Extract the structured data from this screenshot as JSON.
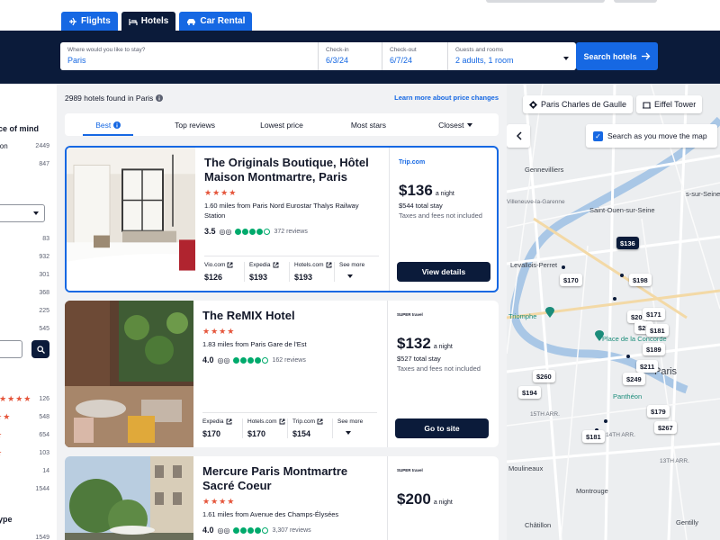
{
  "nav": {
    "tabs": [
      {
        "label": "Flights",
        "icon": "plane-icon"
      },
      {
        "label": "Hotels",
        "icon": "bed-icon"
      },
      {
        "label": "Car Rental",
        "icon": "car-icon"
      }
    ]
  },
  "search": {
    "destination_label": "Where would you like to stay?",
    "destination_value": "Paris",
    "checkin_label": "Check-in",
    "checkin_value": "6/3/24",
    "checkout_label": "Check-out",
    "checkout_value": "6/7/24",
    "guests_label": "Guests and rooms",
    "guests_value": "2 adults, 1 room",
    "button_label": "Search hotels"
  },
  "filters": {
    "heading": "ce of mind",
    "first_item": "ion",
    "counts": [
      "2449",
      "847",
      "83",
      "932",
      "301",
      "368",
      "225",
      "545"
    ],
    "star_rows": [
      {
        "stars": "★★★★★",
        "count": "126"
      },
      {
        "stars": "★★★★",
        "count": "548"
      },
      {
        "stars": "★★★",
        "count": "654"
      },
      {
        "stars": "★★",
        "count": "103"
      },
      {
        "stars": "",
        "count": "14"
      },
      {
        "stars": "",
        "count": "1544"
      }
    ],
    "type_heading": "ype",
    "type_count": "1549"
  },
  "results": {
    "count_text": "2989 hotels found in Paris",
    "learn_more": "Learn more about price changes",
    "sort_options": [
      "Best",
      "Top reviews",
      "Lowest price",
      "Most stars",
      "Closest"
    ]
  },
  "hotels": [
    {
      "name": "The Originals Boutique, Hôtel Maison Montmartre, Paris",
      "stars": "★★★★",
      "distance": "1.60 miles from Paris Nord Eurostar Thalys Railway Station",
      "score": "3.5",
      "reviews": "372 reviews",
      "rating": 3.5,
      "providers": [
        {
          "name": "Vio.com",
          "price": "$126"
        },
        {
          "name": "Expedia",
          "price": "$193"
        },
        {
          "name": "Hotels.com",
          "price": "$193"
        }
      ],
      "see_more": "See more",
      "logo": "Trip.com",
      "price": "$136",
      "per_night": "a night",
      "total": "$544 total stay",
      "taxes": "Taxes and fees not included",
      "cta": "View details"
    },
    {
      "name": "The ReMIX Hotel",
      "stars": "★★★★",
      "distance": "1.83 miles from Paris Gare de l'Est",
      "score": "4.0",
      "reviews": "162 reviews",
      "rating": 4,
      "providers": [
        {
          "name": "Expedia",
          "price": "$170"
        },
        {
          "name": "Hotels.com",
          "price": "$170"
        },
        {
          "name": "Trip.com",
          "price": "$154"
        }
      ],
      "see_more": "See more",
      "logo": "SUPER travel",
      "price": "$132",
      "per_night": "a night",
      "total": "$527 total stay",
      "taxes": "Taxes and fees not included",
      "cta": "Go to site"
    },
    {
      "name": "Mercure Paris Montmartre Sacré Coeur",
      "stars": "★★★★",
      "distance": "1.61 miles from Avenue des Champs-Élysées",
      "score": "4.0",
      "reviews": "3,307 reviews",
      "rating": 4,
      "logo": "SUPER travel",
      "price": "$200",
      "per_night": "a night"
    }
  ],
  "map": {
    "chips": [
      "Paris Charles de Gaulle",
      "Eiffel Tower"
    ],
    "search_move": "Search as you move the map",
    "places": [
      "Gennevilliers",
      "Villeneuve-la-Garenne",
      "Saint-Ouen-sur-Seine",
      "Levallois-Perret",
      "Triomphe",
      "Place de la Concorde",
      "Paris",
      "Panthéon",
      "15TH ARR.",
      "14TH ARR.",
      "13TH ARR.",
      "Moulineaux",
      "Montrouge",
      "Châtillon",
      "s-sur-Seine",
      "Gentilly"
    ],
    "pins": [
      "$136",
      "$170",
      "$198",
      "$20",
      "$171",
      "$25",
      "$181",
      "$189",
      "$211",
      "$249",
      "$260",
      "$194",
      "$179",
      "$267",
      "$181"
    ]
  },
  "colors": {
    "brand_dark": "#0b1b3a",
    "accent": "#1668e3",
    "star": "#e5553b",
    "rating": "#00aa6c"
  }
}
